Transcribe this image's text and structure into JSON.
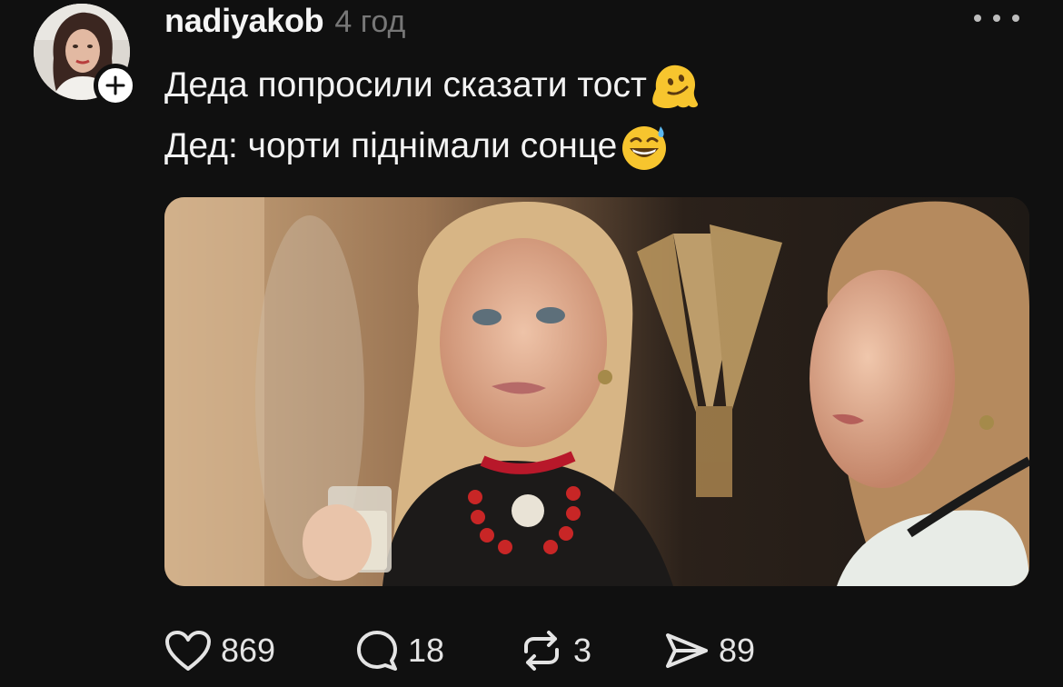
{
  "post": {
    "username": "nadiyakob",
    "timestamp": "4 год",
    "text_line1": "Деда попросили сказати тост",
    "text_line2": "Дед: чорти піднімали сонце",
    "emoji1": "melting-face-emoji",
    "emoji2": "grinning-sweat-emoji",
    "image_description": "two women in Ukrainian embroidered costumes, one holding a shot glass"
  },
  "actions": {
    "likes": "869",
    "replies": "18",
    "reposts": "3",
    "shares": "89"
  },
  "colors": {
    "background": "#101010",
    "text": "#f3f3f3",
    "muted": "#777777",
    "emoji_yellow": "#f7c52e"
  }
}
